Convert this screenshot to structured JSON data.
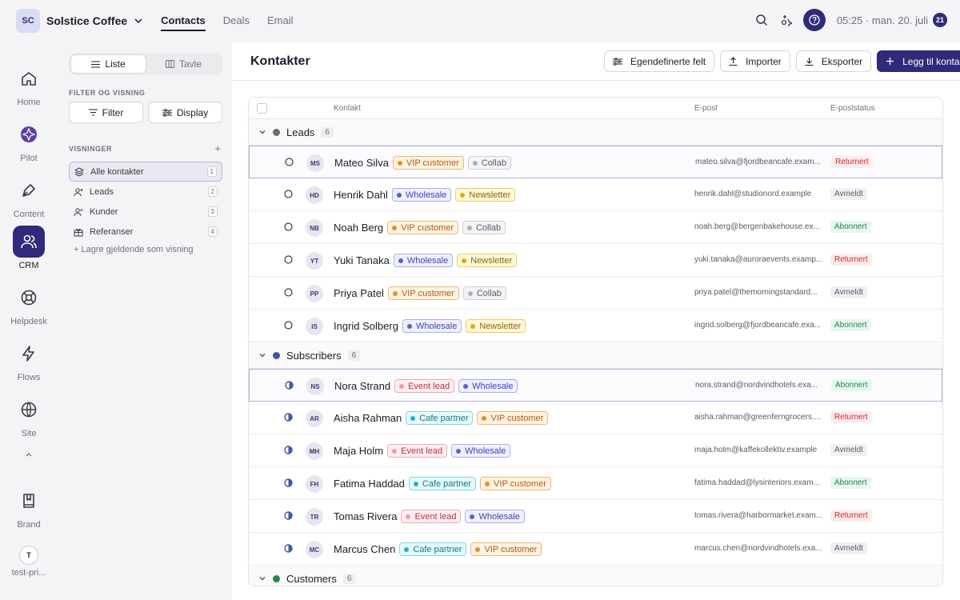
{
  "topbar": {
    "workspace_initials": "SC",
    "workspace_name": "Solstice Coffee",
    "nav": [
      "Contacts",
      "Deals",
      "Email"
    ],
    "datetime": "05:25 · man. 20. juli",
    "calendar_badge": "21"
  },
  "rail": {
    "items": [
      {
        "label": "Home",
        "icon": "home-icon"
      },
      {
        "label": "Pilot",
        "icon": "pilot-icon"
      },
      {
        "label": "Content",
        "icon": "pen-icon"
      },
      {
        "label": "CRM",
        "icon": "users-icon"
      },
      {
        "label": "Helpdesk",
        "icon": "lifebuoy-icon"
      },
      {
        "label": "Flows",
        "icon": "bolt-icon"
      },
      {
        "label": "Site",
        "icon": "globe-icon"
      },
      {
        "label": "Brand",
        "icon": "book-icon"
      },
      {
        "label": "test-pri...",
        "icon": "user-avatar"
      }
    ],
    "user_initial": "T"
  },
  "side": {
    "seg_list": "Liste",
    "seg_board": "Tavle",
    "filter_heading": "FILTER OG VISNING",
    "filter_btn": "Filter",
    "display_btn": "Display",
    "views_heading": "VISNINGER",
    "views": [
      {
        "label": "Alle kontakter",
        "count": "1"
      },
      {
        "label": "Leads",
        "count": "2"
      },
      {
        "label": "Kunder",
        "count": "3"
      },
      {
        "label": "Referanser",
        "count": "4"
      }
    ],
    "save_view": "+ Lagre gjeldende som visning"
  },
  "main": {
    "title": "Kontakter",
    "actions": {
      "custom_fields": "Egendefinerte felt",
      "import": "Importer",
      "export": "Eksporter",
      "add": "Legg til kontakt"
    },
    "columns": {
      "contact": "Kontakt",
      "email": "E-post",
      "email_status": "E-poststatus"
    }
  },
  "colors": {
    "accent": "#2f2a7a"
  },
  "groups": [
    {
      "label": "Leads",
      "count": "6",
      "color": "#6b6b78",
      "status_icon": "circle-empty",
      "contacts": [
        {
          "initials": "MS",
          "name": "Mateo Silva",
          "tags": [
            [
              "VIP customer",
              "orange"
            ],
            [
              "Collab",
              "gray"
            ]
          ],
          "email": "mateo.silva@fjordbeancafe.exam...",
          "status": "Returnert",
          "selected": true
        },
        {
          "initials": "HD",
          "name": "Henrik Dahl",
          "tags": [
            [
              "Wholesale",
              "blue"
            ],
            [
              "Newsletter",
              "yellow"
            ]
          ],
          "email": "henrik.dahl@studionord.example",
          "status": "Avmeldt"
        },
        {
          "initials": "NB",
          "name": "Noah Berg",
          "tags": [
            [
              "VIP customer",
              "orange"
            ],
            [
              "Collab",
              "gray"
            ]
          ],
          "email": "noah.berg@bergenbakehouse.ex...",
          "status": "Abonnert"
        },
        {
          "initials": "YT",
          "name": "Yuki Tanaka",
          "tags": [
            [
              "Wholesale",
              "blue"
            ],
            [
              "Newsletter",
              "yellow"
            ]
          ],
          "email": "yuki.tanaka@auroraevents.examp...",
          "status": "Returnert"
        },
        {
          "initials": "PP",
          "name": "Priya Patel",
          "tags": [
            [
              "VIP customer",
              "orange"
            ],
            [
              "Collab",
              "gray"
            ]
          ],
          "email": "priya.patel@themorningstandard...",
          "status": "Avmeldt"
        },
        {
          "initials": "IS",
          "name": "Ingrid Solberg",
          "tags": [
            [
              "Wholesale",
              "blue"
            ],
            [
              "Newsletter",
              "yellow"
            ]
          ],
          "email": "ingrid.solberg@fjordbeancafe.exa...",
          "status": "Abonnert"
        }
      ]
    },
    {
      "label": "Subscribers",
      "count": "6",
      "color": "#3d5a9e",
      "status_icon": "circle-half",
      "contacts": [
        {
          "initials": "NS",
          "name": "Nora Strand",
          "tags": [
            [
              "Event lead",
              "pink"
            ],
            [
              "Wholesale",
              "blue"
            ]
          ],
          "email": "nora.strand@nordvindhotels.exa...",
          "status": "Abonnert",
          "selected": true
        },
        {
          "initials": "AR",
          "name": "Aisha Rahman",
          "tags": [
            [
              "Cafe partner",
              "teal"
            ],
            [
              "VIP customer",
              "orange"
            ]
          ],
          "email": "aisha.rahman@greenferngrocers....",
          "status": "Returnert"
        },
        {
          "initials": "MH",
          "name": "Maja Holm",
          "tags": [
            [
              "Event lead",
              "pink"
            ],
            [
              "Wholesale",
              "blue"
            ]
          ],
          "email": "maja.holm@kaffekollektiv.example",
          "status": "Avmeldt"
        },
        {
          "initials": "FH",
          "name": "Fatima Haddad",
          "tags": [
            [
              "Cafe partner",
              "teal"
            ],
            [
              "VIP customer",
              "orange"
            ]
          ],
          "email": "fatima.haddad@lysinteriors.exam...",
          "status": "Abonnert"
        },
        {
          "initials": "TR",
          "name": "Tomas Rivera",
          "tags": [
            [
              "Event lead",
              "pink"
            ],
            [
              "Wholesale",
              "blue"
            ]
          ],
          "email": "tomas.rivera@harbormarket.exam...",
          "status": "Returnert"
        },
        {
          "initials": "MC",
          "name": "Marcus Chen",
          "tags": [
            [
              "Cafe partner",
              "teal"
            ],
            [
              "VIP customer",
              "orange"
            ]
          ],
          "email": "marcus.chen@nordvindhotels.exa...",
          "status": "Avmeldt"
        }
      ]
    },
    {
      "label": "Customers",
      "count": "6",
      "color": "#1f8a4c",
      "status_icon": "circle-full",
      "contacts": []
    }
  ]
}
